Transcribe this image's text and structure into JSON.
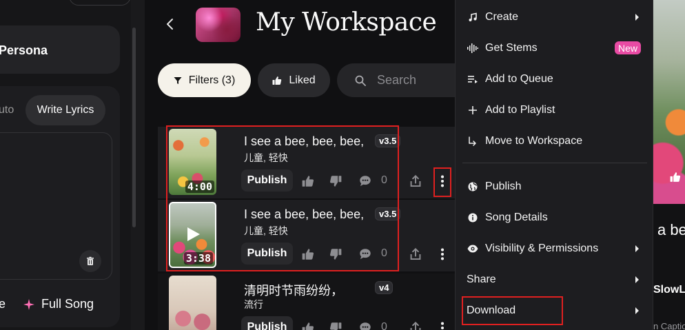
{
  "left_panel": {
    "persona_label": "Persona",
    "auto_tab": "uto",
    "write_lyrics_tab": "Write Lyrics",
    "bottom_left_text": "e",
    "full_song_label": "Full Song"
  },
  "header": {
    "title": "My Workspace"
  },
  "toolbar": {
    "filters_label": "Filters (3)",
    "liked_label": "Liked",
    "search_placeholder": "Search"
  },
  "songs": [
    {
      "title": "I see a bee, bee, bee,",
      "version": "v3.5",
      "tags": "儿童, 轻快",
      "duration": "4:00",
      "publish_label": "Publish",
      "comment_count": "0"
    },
    {
      "title": "I see a bee, bee, bee,",
      "version": "v3.5",
      "tags": "儿童, 轻快",
      "duration": "3:38",
      "publish_label": "Publish",
      "comment_count": "0"
    },
    {
      "title": "清明时节雨纷纷，",
      "version": "v4",
      "tags": "流行",
      "duration": "",
      "publish_label": "Publish",
      "comment_count": "0"
    }
  ],
  "menu": {
    "create": "Create",
    "get_stems": "Get Stems",
    "new_badge": "New",
    "add_to_queue": "Add to Queue",
    "add_to_playlist": "Add to Playlist",
    "move_to_workspace": "Move to Workspace",
    "publish": "Publish",
    "song_details": "Song Details",
    "visibility": "Visibility & Permissions",
    "share": "Share",
    "download": "Download"
  },
  "right_panel": {
    "title_fragment": "a be",
    "sub_fragment": "SlowL",
    "caption_fragment": "n Captio"
  },
  "colors": {
    "highlight_red": "#e02020",
    "new_badge_pink": "#e94ba4",
    "filters_bg": "#f5f2ea"
  }
}
